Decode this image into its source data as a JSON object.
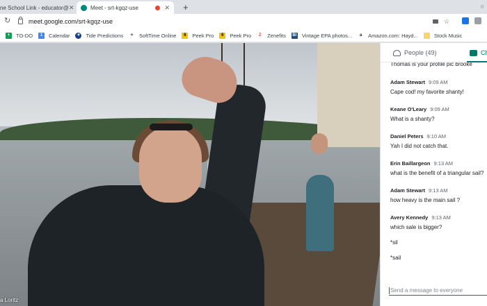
{
  "browser": {
    "tabs": [
      {
        "title": "ne School Link - educator@"
      },
      {
        "title": "Meet - srt-kgqz-use"
      }
    ],
    "new_tab": "+",
    "url": "meet.google.com/srt-kgqz-use"
  },
  "bookmarks": [
    {
      "label": "TO-DO",
      "icon": "sheets-icon",
      "color": "#0f9d58"
    },
    {
      "label": "Calendar",
      "icon": "calendar-icon",
      "color": "#4285f4"
    },
    {
      "label": "Tide Predictions",
      "icon": "noaa-icon",
      "color": "#1a3d8f"
    },
    {
      "label": "SoftTime Online",
      "icon": "softtime-icon",
      "color": "#444444"
    },
    {
      "label": "Peek Pro",
      "icon": "peekpro-icon",
      "color": "#f5c400"
    },
    {
      "label": "Peek Pro",
      "icon": "peekpro-icon",
      "color": "#f5c400"
    },
    {
      "label": "Zenefits",
      "icon": "zenefits-icon",
      "color": "#e8452c"
    },
    {
      "label": "Vintage EPA photos...",
      "icon": "bi-icon",
      "color": "#1f4e79"
    },
    {
      "label": "Amazon.com: Hayd...",
      "icon": "amazon-icon",
      "color": "#222222"
    },
    {
      "label": "Stock Music",
      "icon": "folder-icon",
      "color": "#f9d56e"
    }
  ],
  "video": {
    "participant_name": "a Loritz"
  },
  "panel": {
    "people_tab": "People (49)",
    "chat_tab": "Ch",
    "partial_message": "Thomas is your profile pic brooke",
    "messages": [
      {
        "sender": "Adam Stewart",
        "time": "9:09 AM",
        "text": "Cape cod! my favorite shanty!"
      },
      {
        "sender": "Keane O'Leary",
        "time": "9:09 AM",
        "text": "What is a shanty?"
      },
      {
        "sender": "Daniel Peters",
        "time": "9:10 AM",
        "text": "Yah I did not catch that."
      },
      {
        "sender": "Erin Baillargeon",
        "time": "9:13 AM",
        "text": "what is the benefit of a triangular sail?"
      },
      {
        "sender": "Adam Stewart",
        "time": "9:13 AM",
        "text": "how heavy is the main sail ?"
      },
      {
        "sender": "Avery Kennedy",
        "time": "9:13 AM",
        "text": "which sale is bigger?",
        "extra": [
          "*sil",
          "*sail"
        ]
      }
    ],
    "compose_placeholder": "Send a message to everyone"
  }
}
